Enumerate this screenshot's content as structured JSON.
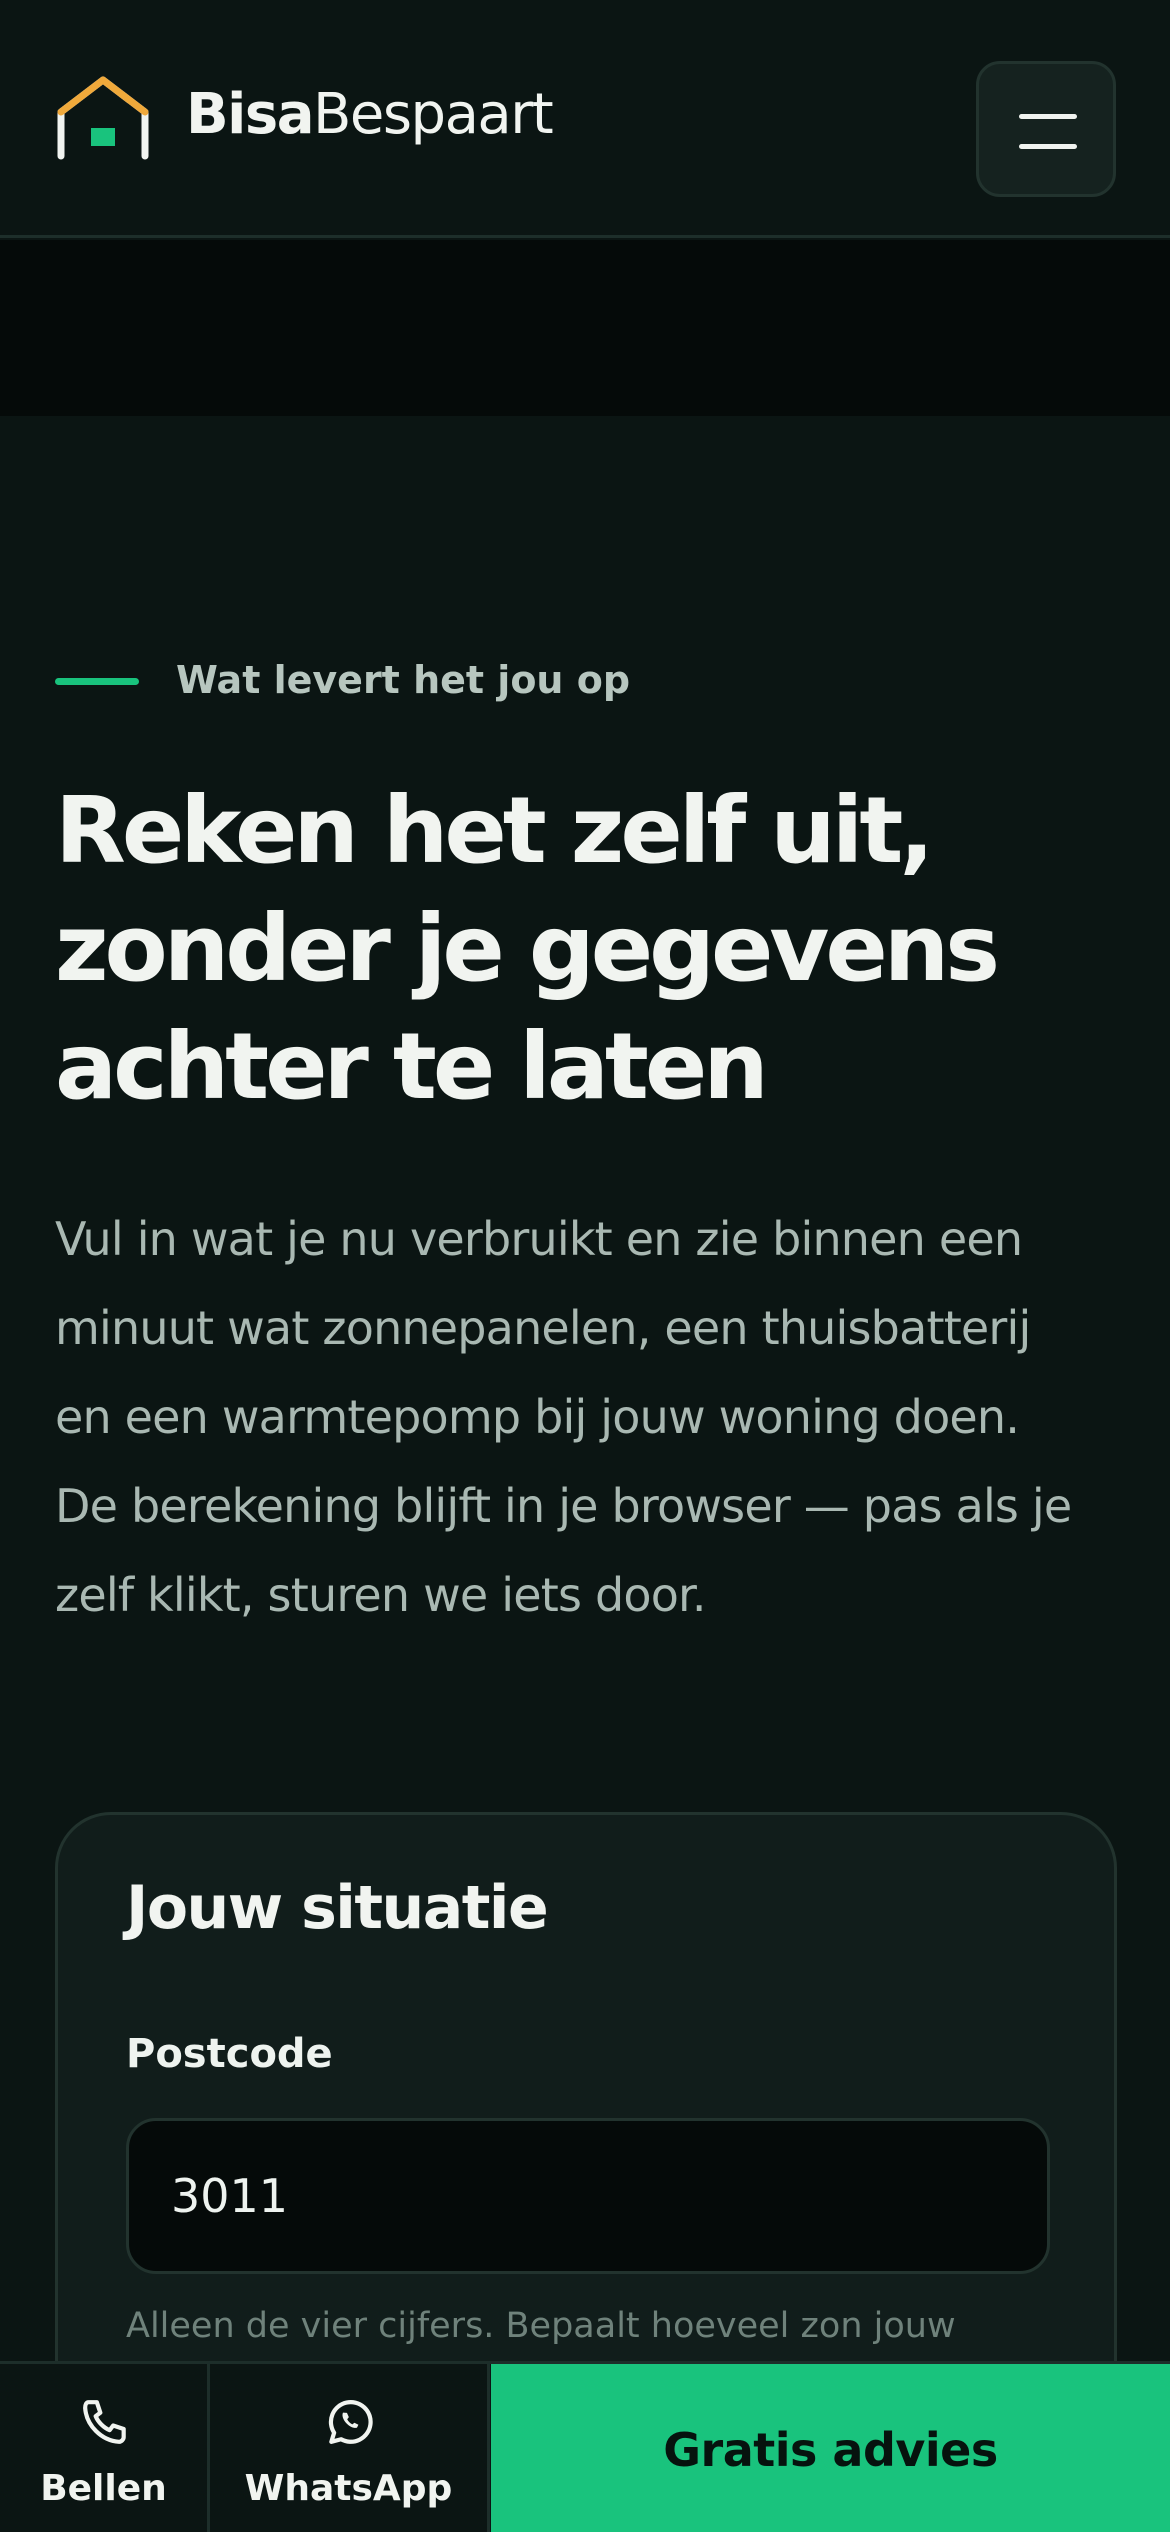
{
  "header": {
    "brand_bold": "Bisa",
    "brand_regular": "Bespaart",
    "logo_icon": "house-logo-icon",
    "menu_icon": "hamburger-menu-icon"
  },
  "hero": {
    "eyebrow": "Wat levert het jou op",
    "heading_lines": [
      "Reken het zelf uit,",
      "zonder je gegevens",
      "achter te laten"
    ],
    "intro_lines": [
      "Vul in wat je nu verbruikt en zie binnen een",
      "minuut wat zonnepanelen, een thuisbatterij",
      "en een warmtepomp bij jouw woning doen.",
      "De berekening blijft in je browser — pas als je",
      "zelf klikt, sturen we iets door."
    ]
  },
  "calculator": {
    "title": "Jouw situatie",
    "postcode": {
      "label": "Postcode",
      "value": "3011",
      "hint": "Alleen de vier cijfers. Bepaalt hoeveel zon jouw"
    }
  },
  "bottom_bar": {
    "call_label": "Bellen",
    "whatsapp_label": "WhatsApp",
    "cta_label": "Gratis advies",
    "call_icon": "phone-icon",
    "whatsapp_icon": "whatsapp-icon"
  },
  "colors": {
    "accent": "#19c37d",
    "logo_roof": "#f0a93b",
    "background": "#0b1513",
    "card": "#111d1b"
  }
}
